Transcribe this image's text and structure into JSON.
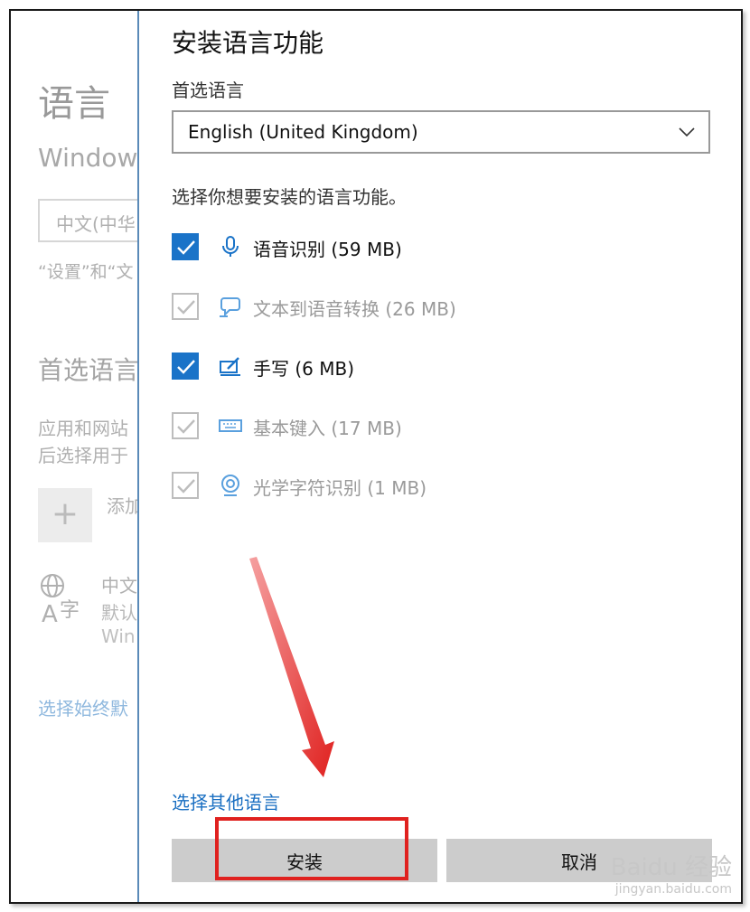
{
  "background_page": {
    "title": "语言",
    "subtitle": "Window",
    "display_lang_value": "中文(中华",
    "note": "“设置”和“文",
    "preferred_heading": "首选语言",
    "pref_desc_1": "应用和网站",
    "pref_desc_2": "后选择用于",
    "add_label": "添加",
    "lang_line_1": "中文",
    "lang_line_2": "默认",
    "lang_line_3": "Win",
    "link": "选择始终默"
  },
  "dialog": {
    "title": "安装语言功能",
    "preferred_label": "首选语言",
    "dropdown_value": "English (United Kingdom)",
    "instruction": "选择你想要安装的语言功能。",
    "features": [
      {
        "label": "语音识别 (59 MB)",
        "checked": true,
        "enabled": true,
        "icon": "microphone-icon"
      },
      {
        "label": "文本到语音转换 (26 MB)",
        "checked": true,
        "enabled": false,
        "icon": "speech-bubble-icon"
      },
      {
        "label": "手写 (6 MB)",
        "checked": true,
        "enabled": true,
        "icon": "pen-icon"
      },
      {
        "label": "基本键入 (17 MB)",
        "checked": true,
        "enabled": false,
        "icon": "keyboard-icon"
      },
      {
        "label": "光学字符识别 (1 MB)",
        "checked": true,
        "enabled": false,
        "icon": "ocr-icon"
      }
    ],
    "other_languages_link": "选择其他语言",
    "install_button": "安装",
    "cancel_button": "取消"
  },
  "colors": {
    "accent": "#1a73c8",
    "annotation": "#e0211f"
  },
  "watermark": {
    "text": "Baidu 经验",
    "url": "jingyan.baidu.com"
  }
}
